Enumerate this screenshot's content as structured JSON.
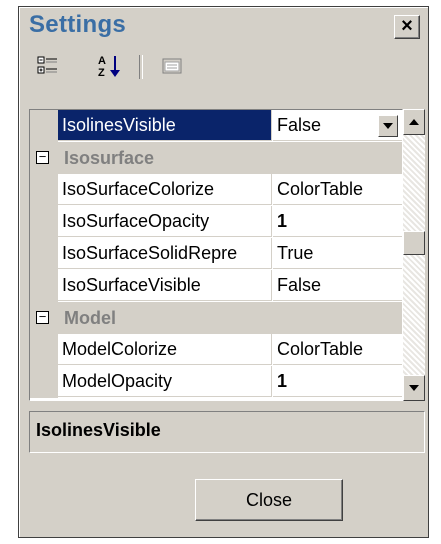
{
  "window": {
    "title": "Settings",
    "close_glyph": "×"
  },
  "toolbar": {
    "buttons": [
      {
        "name": "categorized-icon"
      },
      {
        "name": "alphabetical-sort-icon"
      },
      {
        "name": "property-pages-icon"
      }
    ]
  },
  "grid": {
    "rows": [
      {
        "type": "property",
        "name": "IsolinesVisible",
        "value": "False",
        "selected": true,
        "dropdown": true
      },
      {
        "type": "category",
        "label": "Isosurface",
        "toggle": "−"
      },
      {
        "type": "property",
        "name": "IsoSurfaceColorize",
        "value": "ColorTable"
      },
      {
        "type": "property",
        "name": "IsoSurfaceOpacity",
        "value": "1",
        "bold": true
      },
      {
        "type": "property",
        "name": "IsoSurfaceSolidRepre",
        "value": "True"
      },
      {
        "type": "property",
        "name": "IsoSurfaceVisible",
        "value": "False"
      },
      {
        "type": "category",
        "label": "Model",
        "toggle": "−"
      },
      {
        "type": "property",
        "name": "ModelColorize",
        "value": "ColorTable"
      },
      {
        "type": "property",
        "name": "ModelOpacity",
        "value": "1",
        "bold": true
      }
    ]
  },
  "description": {
    "title": "IsolinesVisible"
  },
  "footer": {
    "close_label": "Close"
  }
}
